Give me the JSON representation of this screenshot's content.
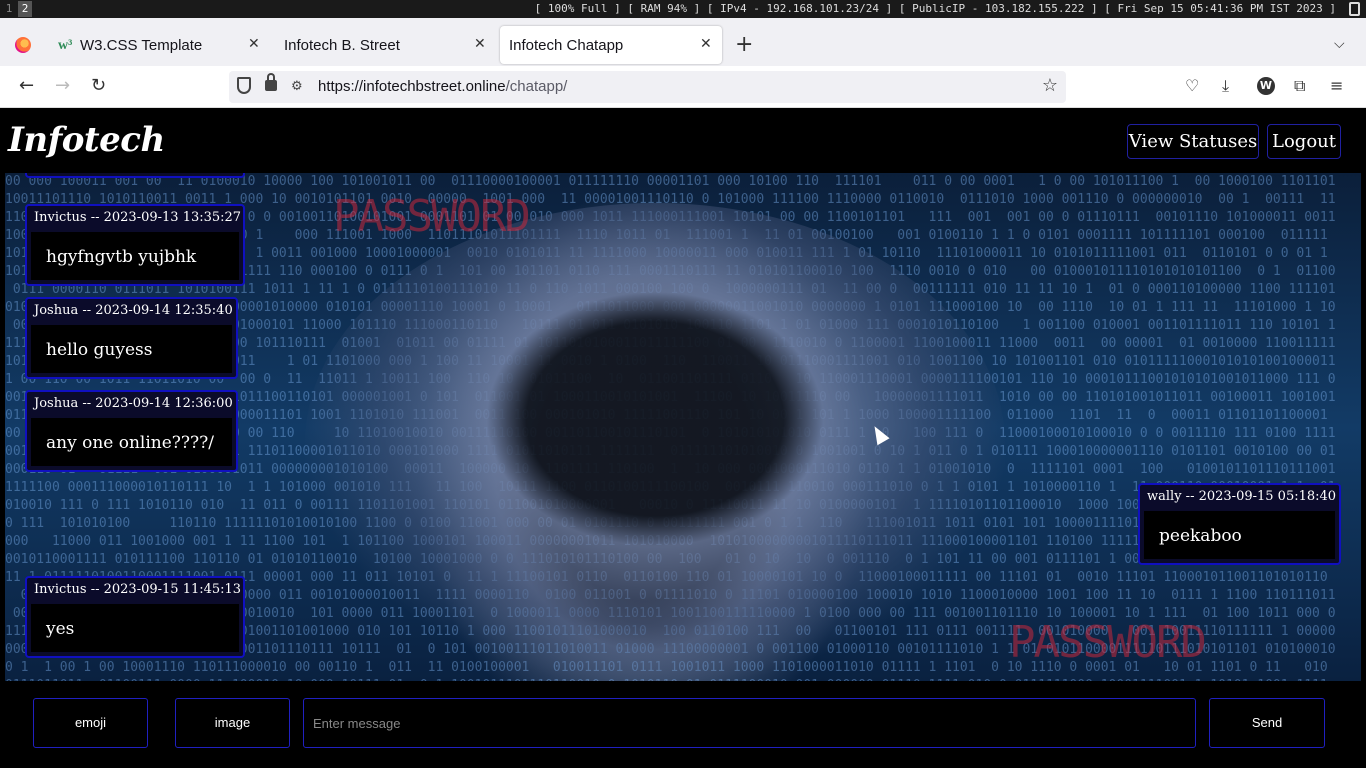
{
  "system_bar": {
    "workspaces": [
      "1",
      "2"
    ],
    "info": "[ 100% Full ] [ RAM 94% ] [ IPv4 - 192.168.101.23/24 ] [ PublicIP - 103.182.155.222 ] [ Fri Sep 15 05:41:36 PM IST 2023 ]"
  },
  "browser": {
    "tabs": [
      {
        "label": "W3.CSS Template",
        "icon": "w3schools-icon"
      },
      {
        "label": "Infotech B. Street"
      },
      {
        "label": "Infotech Chatapp",
        "active": true
      }
    ],
    "url_host": "https://infotechbstreet.online",
    "url_path": "/chatapp/"
  },
  "site": {
    "logo": "Infotech",
    "view_statuses": "View Statuses",
    "logout": "Logout"
  },
  "background_marks": {
    "top": "PASSWORD",
    "bottom": "PASSWORD"
  },
  "messages": [
    {
      "meta": "",
      "text": ""
    },
    {
      "meta": "Invictus -- 2023-09-13 13:35:27",
      "text": "hgyfngvtb yujbhk"
    },
    {
      "meta": "Joshua -- 2023-09-14 12:35:40",
      "text": "hello guyess"
    },
    {
      "meta": "Joshua -- 2023-09-14 12:36:00",
      "text": "any one online????/"
    },
    {
      "meta": "wally -- 2023-09-15 05:18:40",
      "text": "peekaboo"
    },
    {
      "meta": "Invictus -- 2023-09-15 11:45:13",
      "text": "yes"
    }
  ],
  "composer": {
    "emoji": "emoji",
    "image": "image",
    "placeholder": "Enter message",
    "send": "Send"
  },
  "colors": {
    "accent_border": "#1010c0",
    "header_bg": "#000000"
  }
}
